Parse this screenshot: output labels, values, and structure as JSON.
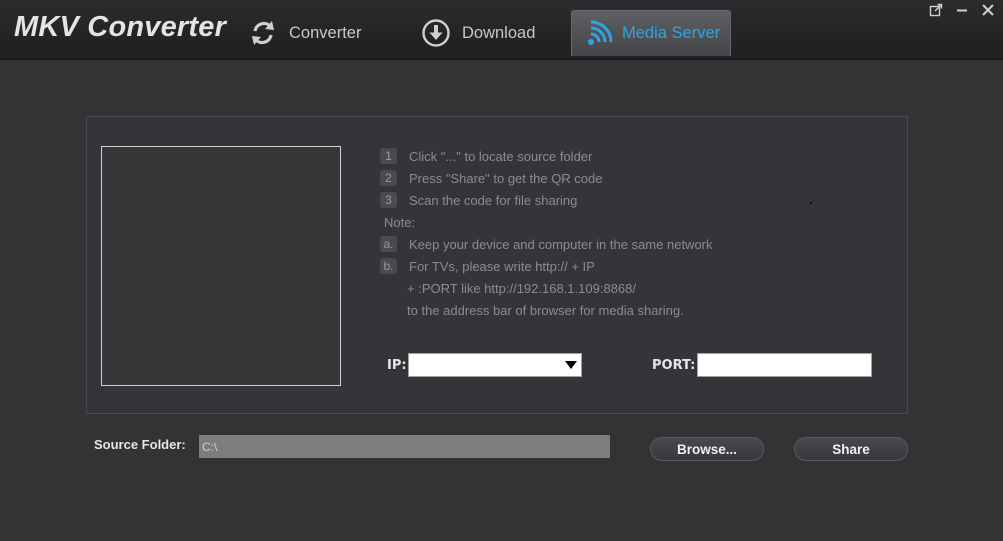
{
  "app": {
    "title": "MKV Converter"
  },
  "tabs": [
    {
      "label": "Converter",
      "icon": "refresh-icon"
    },
    {
      "label": "Download",
      "icon": "download-icon"
    },
    {
      "label": "Media Server",
      "icon": "wifi-icon",
      "active": true
    }
  ],
  "window_controls": [
    "popout-icon",
    "minimize-icon",
    "close-icon"
  ],
  "instructions": {
    "steps": [
      {
        "num": "1",
        "text": "Click \"...\" to locate source folder"
      },
      {
        "num": "2",
        "text": "Press \"Share\" to get the QR code"
      },
      {
        "num": "3",
        "text": "Scan the code for file sharing"
      }
    ],
    "note_title": "Note:",
    "notes": [
      {
        "num": "a.",
        "text": "Keep your device and computer in the same network"
      },
      {
        "num": "b.",
        "text": "For TVs, please write http:// + IP"
      }
    ],
    "note_continued": [
      "+ :PORT like http://192.168.1.109:8868/",
      "to the address bar of browser for media sharing."
    ]
  },
  "ip": {
    "label": "IP:",
    "value": ""
  },
  "port": {
    "label": "PORT:",
    "value": ""
  },
  "source_folder": {
    "label": "Source Folder:",
    "value": "C:\\"
  },
  "buttons": {
    "browse": "Browse...",
    "share": "Share"
  },
  "colors": {
    "accent": "#2aa6e6",
    "background": "#333336",
    "topbar": "#252527"
  }
}
